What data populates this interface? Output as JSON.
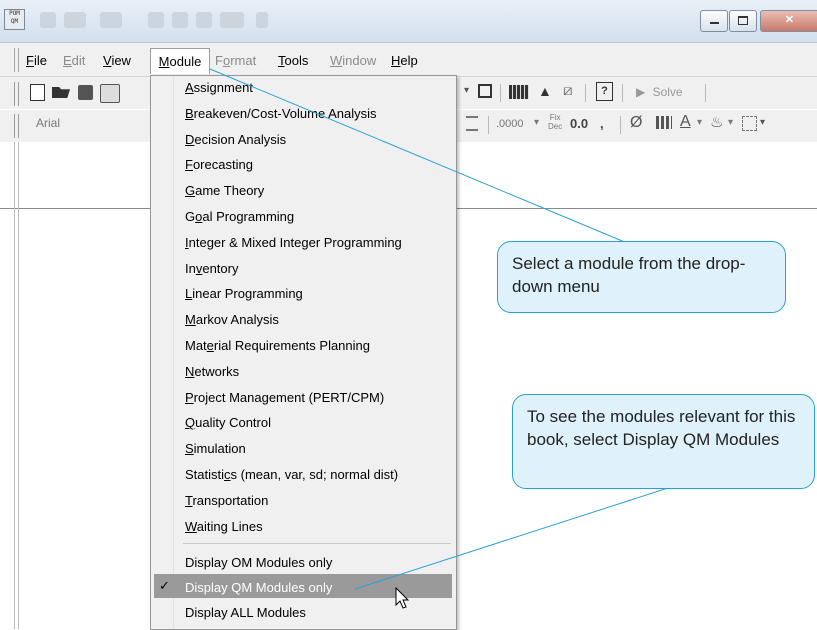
{
  "title_bar": {
    "app_icon": "POM-QM app icon",
    "app_icon_text": "POM QM",
    "buttons": [
      "minimize",
      "maximize",
      "close"
    ]
  },
  "menubar": {
    "items": [
      {
        "label": "File",
        "ul": "F",
        "rest": "ile",
        "enabled": true
      },
      {
        "label": "Edit",
        "ul": "E",
        "rest": "dit",
        "enabled": false
      },
      {
        "label": "View",
        "ul": "V",
        "rest": "iew",
        "enabled": true
      },
      {
        "label": "Module",
        "ul": "M",
        "rest": "odule",
        "enabled": true
      },
      {
        "label": "Format",
        "ul": "o",
        "pre": "F",
        "rest": "rmat",
        "enabled": false
      },
      {
        "label": "Tools",
        "ul": "T",
        "rest": "ools",
        "enabled": true
      },
      {
        "label": "Window",
        "ul": "W",
        "rest": "indow",
        "enabled": false
      },
      {
        "label": "Help",
        "ul": "H",
        "rest": "elp",
        "enabled": true
      }
    ]
  },
  "toolbar": {
    "solve_label": "Solve",
    "font_name": "Arial",
    "number_format": ".0000",
    "fix_dec_top": "Fix",
    "fix_dec_bottom": "Dec",
    "decimal_value": "0.0",
    "comma": ",",
    "icons": [
      "new-icon",
      "open-icon",
      "save-icon",
      "print-icon",
      "grid-icon",
      "chart-icon",
      "mountain-icon",
      "marker-icon",
      "help-icon",
      "play-icon",
      "align-icon",
      "zero-slash-icon",
      "bars-icon",
      "font-color-icon",
      "fill-color-icon",
      "borders-icon"
    ]
  },
  "module_menu": {
    "items": [
      {
        "pre": "",
        "ul": "A",
        "post": "ssignment"
      },
      {
        "pre": "",
        "ul": "B",
        "post": "reakeven/Cost-Volume Analysis"
      },
      {
        "pre": "",
        "ul": "D",
        "post": "ecision Analysis"
      },
      {
        "pre": "",
        "ul": "F",
        "post": "orecasting"
      },
      {
        "pre": "",
        "ul": "G",
        "post": "ame Theory"
      },
      {
        "pre": "G",
        "ul": "o",
        "post": "al Programming"
      },
      {
        "pre": "",
        "ul": "I",
        "post": "nteger & Mixed Integer Programming"
      },
      {
        "pre": "In",
        "ul": "v",
        "post": "entory"
      },
      {
        "pre": "",
        "ul": "L",
        "post": "inear Programming"
      },
      {
        "pre": "",
        "ul": "M",
        "post": "arkov Analysis"
      },
      {
        "pre": "Mat",
        "ul": "e",
        "post": "rial Requirements Planning"
      },
      {
        "pre": "",
        "ul": "N",
        "post": "etworks"
      },
      {
        "pre": "",
        "ul": "P",
        "post": "roject Management (PERT/CPM)"
      },
      {
        "pre": "",
        "ul": "Q",
        "post": "uality Control"
      },
      {
        "pre": "",
        "ul": "S",
        "post": "imulation"
      },
      {
        "pre": "Statisti",
        "ul": "c",
        "post": "s (mean, var, sd; normal dist)"
      },
      {
        "pre": "",
        "ul": "T",
        "post": "ransportation"
      },
      {
        "pre": "",
        "ul": "W",
        "post": "aiting Lines"
      }
    ],
    "display_options": [
      {
        "label": "Display OM Modules only",
        "checked": false,
        "highlighted": false
      },
      {
        "label": "Display QM Modules only",
        "checked": true,
        "highlighted": true
      },
      {
        "label": "Display ALL Modules",
        "checked": false,
        "highlighted": false
      }
    ],
    "check_mark": "✓"
  },
  "callouts": {
    "module_select": "Select a module from the drop-down menu",
    "display_qm": "To see the modules relevant for this book, select Display QM Modules"
  },
  "colors": {
    "callout_fill": "#dff1fb",
    "callout_border": "#2aa1d6",
    "highlight": "#9a9a9a"
  }
}
